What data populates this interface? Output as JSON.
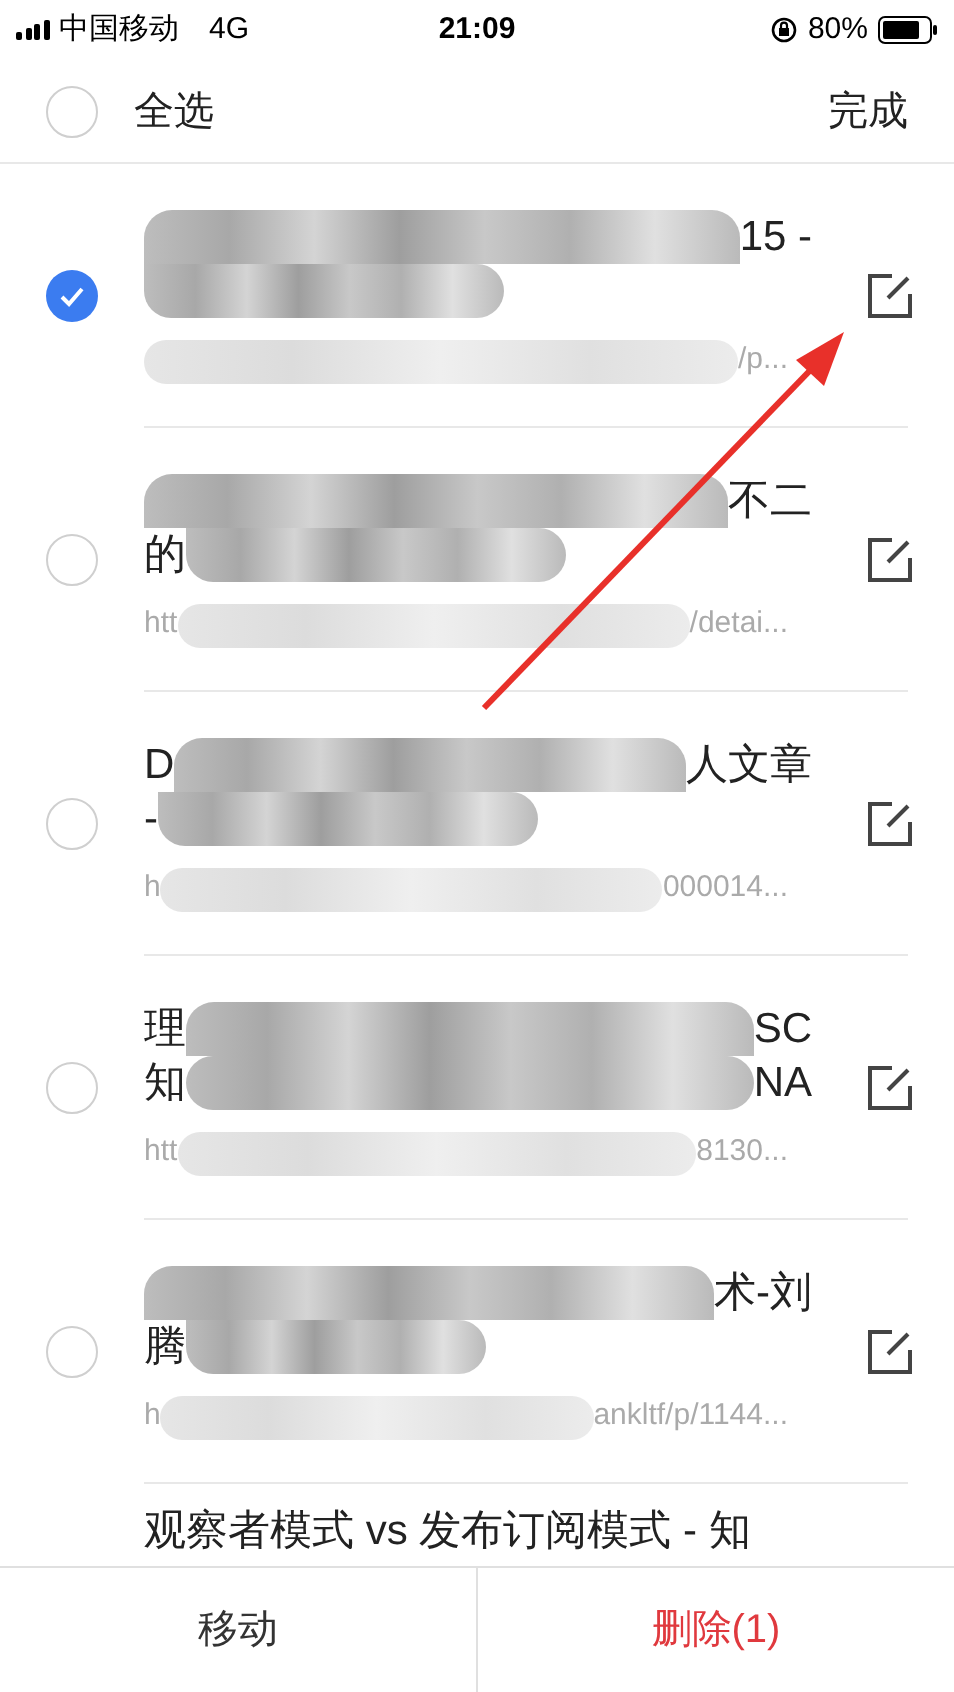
{
  "status_bar": {
    "carrier": "中国移动",
    "network": "4G",
    "time": "21:09",
    "battery": "80%"
  },
  "header": {
    "select_all": {
      "label": "全选",
      "checked": false
    },
    "done": "完成"
  },
  "items": [
    {
      "selected": true,
      "title_lines": [
        {
          "end": "15 -"
        }
      ],
      "url": {
        "end": "/p..."
      }
    },
    {
      "selected": false,
      "title_lines": [
        {
          "end": "不二"
        },
        {
          "start": "的"
        }
      ],
      "url": {
        "start": "htt",
        "end": "/detai..."
      }
    },
    {
      "selected": false,
      "title_lines": [
        {
          "start": "D",
          "end": "人文章"
        },
        {
          "start": "-"
        }
      ],
      "url": {
        "start": "h",
        "end": "000014..."
      }
    },
    {
      "selected": false,
      "title_lines": [
        {
          "start": "理",
          "end": "SC"
        },
        {
          "start": "知",
          "end": "NA"
        }
      ],
      "url": {
        "start": "htt",
        "end": "8130..."
      }
    },
    {
      "selected": false,
      "title_lines": [
        {
          "end": "术-刘"
        },
        {
          "start": "腾"
        }
      ],
      "url": {
        "start": "h",
        "end": "ankltf/p/1144..."
      }
    }
  ],
  "partial_item": {
    "title": "观察者模式 vs 发布订阅模式 - 知"
  },
  "bottom_bar": {
    "move": "移动",
    "delete": "删除(1)"
  }
}
